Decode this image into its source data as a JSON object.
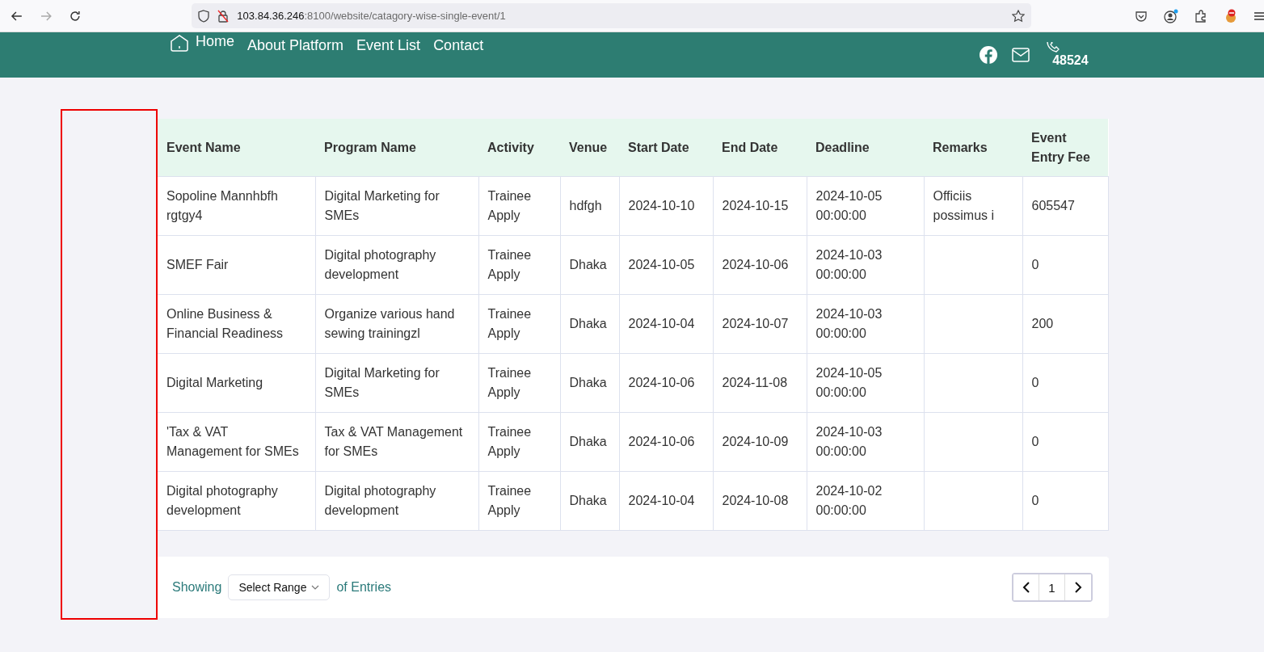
{
  "browser": {
    "url_host": "103.84.36.246",
    "url_path": ":8100/website/catagory-wise-single-event/1"
  },
  "nav": {
    "items": [
      {
        "label": "Home",
        "kind": "home"
      },
      {
        "label": "About Platform",
        "kind": "link"
      },
      {
        "label": "Event List",
        "kind": "link"
      },
      {
        "label": "Contact",
        "kind": "link"
      }
    ],
    "phone": "48524"
  },
  "table": {
    "columns": [
      "Event Name",
      "Program Name",
      "Activity",
      "Venue",
      "Start Date",
      "End Date",
      "Deadline",
      "Remarks",
      "Event Entry Fee"
    ],
    "rows": [
      [
        "Sopoline Mannhbfh rgtgy4",
        "Digital Marketing for SMEs",
        "Trainee Apply",
        "hdfgh",
        "2024-10-10",
        "2024-10-15",
        "2024-10-05 00:00:00",
        "Officiis possimus i",
        "605547"
      ],
      [
        "SMEF Fair",
        "Digital photography development",
        "Trainee Apply",
        "Dhaka",
        "2024-10-05",
        "2024-10-06",
        "2024-10-03 00:00:00",
        "",
        "0"
      ],
      [
        "Online Business & Financial Readiness",
        "Organize various hand sewing trainingzl",
        "Trainee Apply",
        "Dhaka",
        "2024-10-04",
        "2024-10-07",
        "2024-10-03 00:00:00",
        "",
        "200"
      ],
      [
        "Digital Marketing",
        "Digital Marketing for SMEs",
        "Trainee Apply",
        "Dhaka",
        "2024-10-06",
        "2024-11-08",
        "2024-10-05 00:00:00",
        "",
        "0"
      ],
      [
        "'Tax & VAT Management for SMEs",
        "Tax & VAT Management for SMEs",
        "Trainee Apply",
        "Dhaka",
        "2024-10-06",
        "2024-10-09",
        "2024-10-03 00:00:00",
        "",
        "0"
      ],
      [
        "Digital photography development",
        "Digital photography development",
        "Trainee Apply",
        "Dhaka",
        "2024-10-04",
        "2024-10-08",
        "2024-10-02 00:00:00",
        "",
        "0"
      ]
    ]
  },
  "footer": {
    "showing": "Showing",
    "range_select": "Select Range",
    "of_entries": "of Entries",
    "pages": [
      {
        "label": "1",
        "selected": true
      }
    ]
  }
}
